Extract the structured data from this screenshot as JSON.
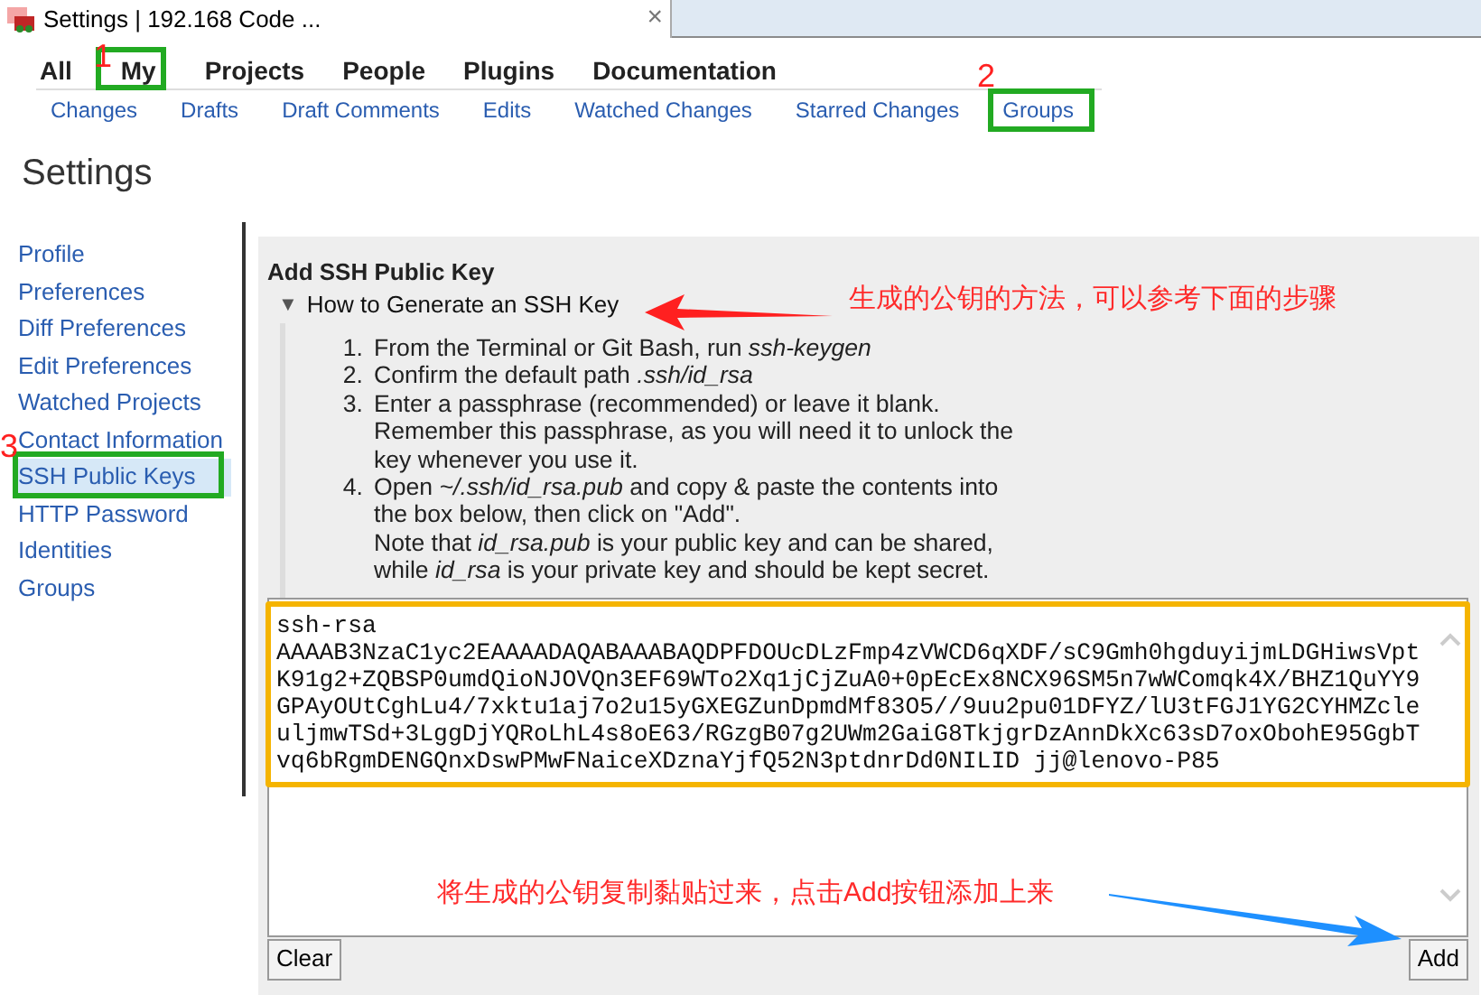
{
  "browser_tab": {
    "title": "Settings | 192.168 Code ...",
    "close": "×"
  },
  "top_nav": [
    {
      "label": "All",
      "selected": false
    },
    {
      "label": "My",
      "selected": true
    },
    {
      "label": "Projects",
      "selected": false
    },
    {
      "label": "People",
      "selected": false
    },
    {
      "label": "Plugins",
      "selected": false
    },
    {
      "label": "Documentation",
      "selected": false
    }
  ],
  "sub_nav": [
    {
      "label": "Changes"
    },
    {
      "label": "Drafts"
    },
    {
      "label": "Draft Comments"
    },
    {
      "label": "Edits"
    },
    {
      "label": "Watched Changes"
    },
    {
      "label": "Starred Changes"
    },
    {
      "label": "Groups"
    }
  ],
  "page_title": "Settings",
  "sidebar": [
    {
      "label": "Profile",
      "selected": false
    },
    {
      "label": "Preferences",
      "selected": false
    },
    {
      "label": "Diff Preferences",
      "selected": false
    },
    {
      "label": "Edit Preferences",
      "selected": false
    },
    {
      "label": "Watched Projects",
      "selected": false
    },
    {
      "label": "Contact Information",
      "selected": false
    },
    {
      "label": "SSH Public Keys",
      "selected": true
    },
    {
      "label": "HTTP Password",
      "selected": false
    },
    {
      "label": "Identities",
      "selected": false
    },
    {
      "label": "Groups",
      "selected": false
    }
  ],
  "panel": {
    "title": "Add SSH Public Key",
    "help": {
      "toggle": "▼",
      "title": "How to Generate an SSH Key",
      "expanded": true,
      "steps": [
        {
          "number": "1.",
          "text": [
            "From the Terminal or Git Bash, run *ssh-keygen*"
          ]
        },
        {
          "number": "2.",
          "text": [
            "Confirm the default path *.ssh/id_rsa*"
          ]
        },
        {
          "number": "3.",
          "text": [
            "Enter a passphrase (recommended) or leave it blank.",
            "Remember this passphrase, as you will need it to unlock the key whenever you use it."
          ]
        },
        {
          "number": "4.",
          "text": [
            "Open *~/.ssh/id_rsa.pub* and copy & paste the contents into the box below, then click on \"Add\".",
            "Note that *id_rsa.pub* is your public key and can be shared, while *id_rsa* is your private key and should be kept secret."
          ]
        }
      ]
    },
    "key_value": [
      "ssh-rsa",
      "AAAAB3NzaC1yc2EAAAADAQABAAABAQDPFDOUcDLzFmp4zVWCD6qXDF/sC9Gmh0hgduyijmLDGHiwsVpt",
      "K91g2+ZQBSP0umdQioNJOVQn3EF69WTo2Xq1jCjZuA0+0pEcEx8NCX96SM5n7wWComqk4X/BHZ1QuYY9",
      "GPAyOUtCghLu4/7xktu1aj7o2u15yGXEGZunDpmdMf83O5//9uu2pu01DFYZ/lU3tFGJ1YG2CYHMZcle",
      "uljmwTSd+3LggDjYQRoLhL4s8oE63/RGzgB07g2UWm2GaiG8TkjgrDzAnnDkXc63sD7oxObohE95GgbT",
      "vq6bRgmDENGQnxDswPMwFNaiceXDznaYjfQ52N3ptdnrDd0NILID jj@lenovo-P85"
    ],
    "buttons": [
      {
        "label": "Clear"
      },
      {
        "label": "Add"
      }
    ]
  },
  "annotations": [
    {
      "kind": "number",
      "text": "1"
    },
    {
      "kind": "number",
      "text": "2"
    },
    {
      "kind": "number",
      "text": "3"
    },
    {
      "kind": "note",
      "text": "生成的公钥的方法，可以参考下面的步骤",
      "color": "#ff2a2a"
    },
    {
      "kind": "note",
      "text": "将生成的公钥复制黏贴过来，点击Add按钮添加上来",
      "color": "#ff2a2a"
    }
  ]
}
